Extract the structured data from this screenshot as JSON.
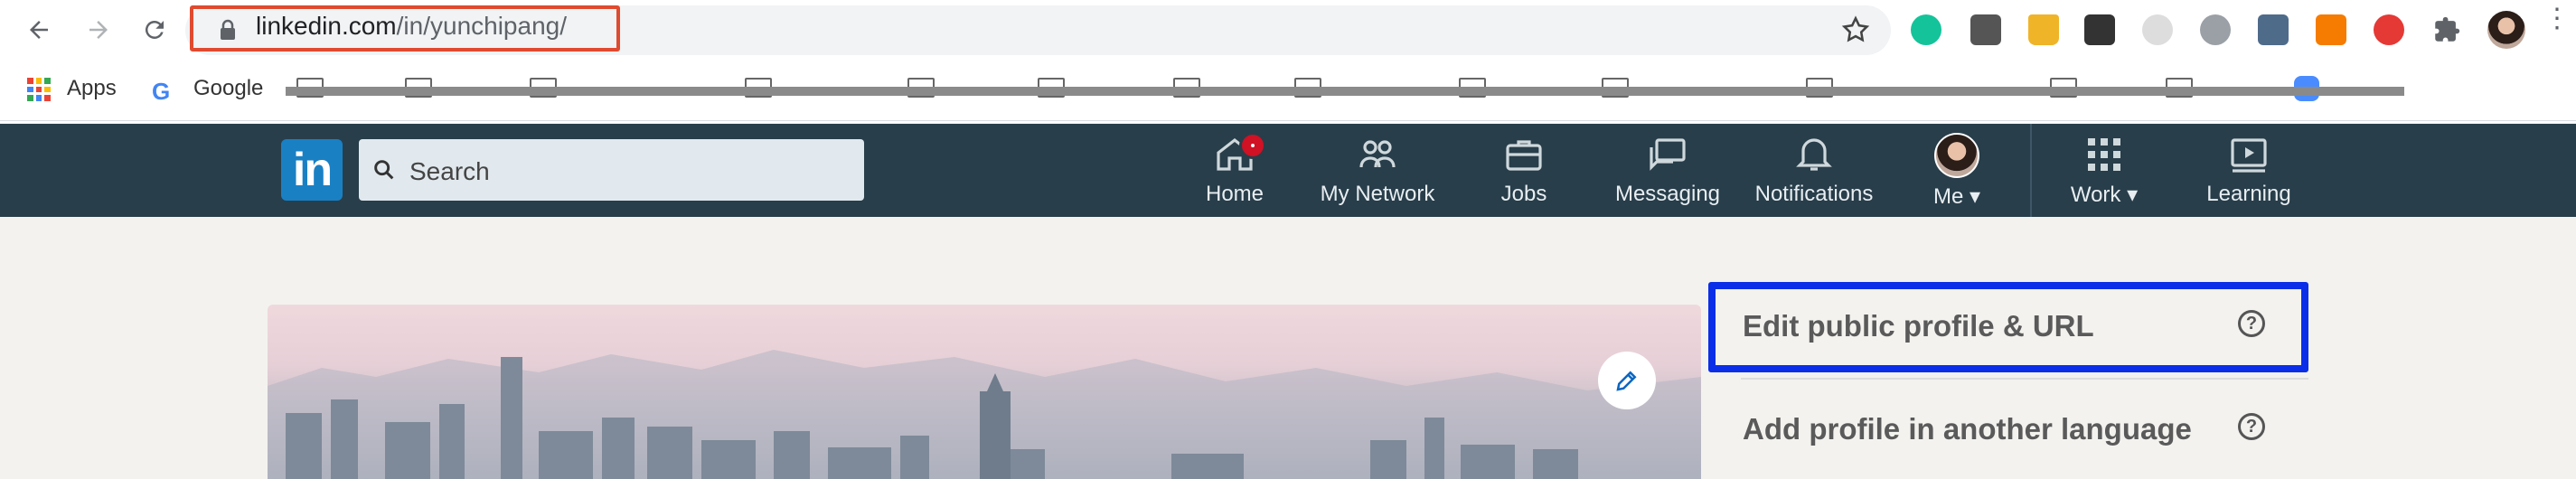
{
  "browser": {
    "url_host": "linkedin.com",
    "url_path": "/in/yunchipang/",
    "bookmarks": {
      "apps_label": "Apps",
      "google_label": "Google"
    }
  },
  "linkedin_nav": {
    "search_placeholder": "Search",
    "items": [
      {
        "label": "Home",
        "icon": "home-icon"
      },
      {
        "label": "My Network",
        "icon": "network-icon"
      },
      {
        "label": "Jobs",
        "icon": "briefcase-icon"
      },
      {
        "label": "Messaging",
        "icon": "messaging-icon"
      },
      {
        "label": "Notifications",
        "icon": "bell-icon"
      },
      {
        "label": "Me",
        "icon": "avatar"
      },
      {
        "label": "Work",
        "icon": "grid-icon"
      },
      {
        "label": "Learning",
        "icon": "learning-icon"
      }
    ]
  },
  "sidebar": {
    "edit_public_profile": "Edit public profile & URL",
    "add_profile_language": "Add profile in another language"
  },
  "colors": {
    "nav_bg": "#283e4a",
    "linkedin_blue": "#1a80c4",
    "highlight_red": "#e04a2f",
    "highlight_blue": "#0b2ee8",
    "notification_badge": "#d11124"
  }
}
